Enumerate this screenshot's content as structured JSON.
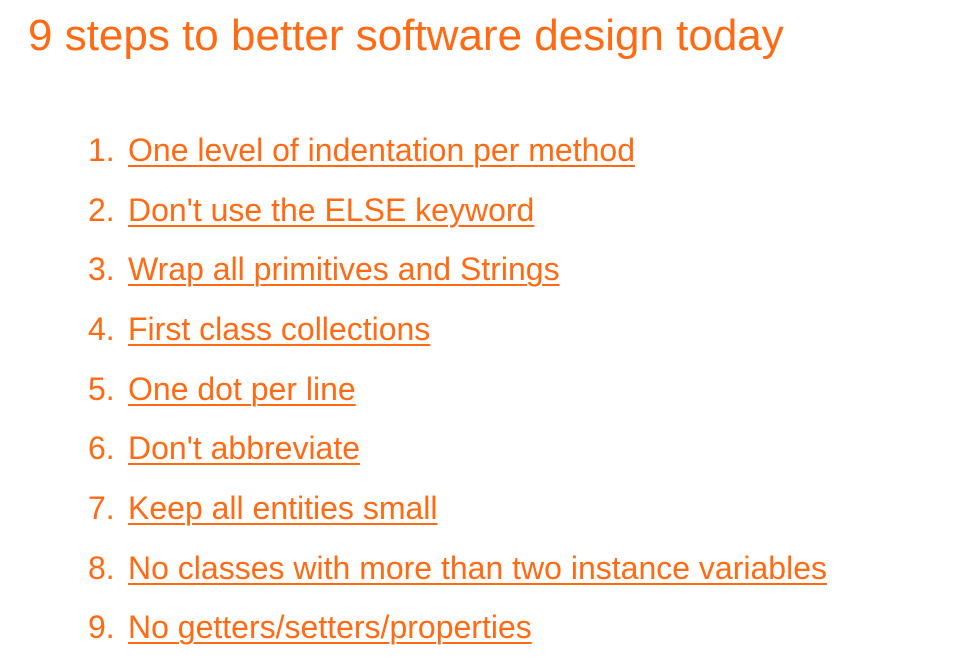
{
  "title": "9 steps to better software design today",
  "colors": {
    "accent": "#ff6a13",
    "background": "#ffffff"
  },
  "steps": [
    {
      "number": "1.",
      "label": "One level of indentation per method"
    },
    {
      "number": "2.",
      "label": "Don't use the ELSE keyword"
    },
    {
      "number": "3.",
      "label": "Wrap all primitives and Strings"
    },
    {
      "number": "4.",
      "label": "First class collections"
    },
    {
      "number": "5.",
      "label": "One dot per line"
    },
    {
      "number": "6.",
      "label": "Don't abbreviate"
    },
    {
      "number": "7.",
      "label": "Keep all entities small"
    },
    {
      "number": "8.",
      "label": "No classes with more than two instance variables"
    },
    {
      "number": "9.",
      "label": "No getters/setters/properties"
    }
  ]
}
